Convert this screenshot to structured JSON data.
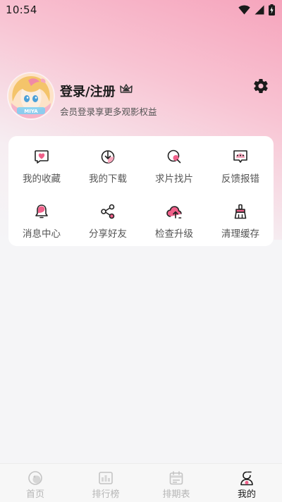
{
  "status_bar": {
    "time": "10:54"
  },
  "profile": {
    "title": "登录/注册",
    "subtitle": "会员登录享更多观影权益",
    "avatar_badge": "MIYA"
  },
  "grid": [
    {
      "label": "我的收藏",
      "icon": "heart-chat-icon"
    },
    {
      "label": "我的下载",
      "icon": "download-icon"
    },
    {
      "label": "求片找片",
      "icon": "search-film-icon"
    },
    {
      "label": "反馈报错",
      "icon": "feedback-icon"
    },
    {
      "label": "消息中心",
      "icon": "bell-icon"
    },
    {
      "label": "分享好友",
      "icon": "share-icon"
    },
    {
      "label": "检查升级",
      "icon": "cloud-upload-icon"
    },
    {
      "label": "清理缓存",
      "icon": "broom-icon"
    }
  ],
  "bottom_nav": [
    {
      "label": "首页",
      "icon": "home-icon",
      "active": false
    },
    {
      "label": "排行榜",
      "icon": "ranking-icon",
      "active": false
    },
    {
      "label": "排期表",
      "icon": "calendar-icon",
      "active": false
    },
    {
      "label": "我的",
      "icon": "profile-icon",
      "active": true
    }
  ],
  "colors": {
    "accent": "#f0608a",
    "accent_light": "#f9a9bf",
    "icon_line": "#222222",
    "inactive": "#b6b6b6"
  }
}
